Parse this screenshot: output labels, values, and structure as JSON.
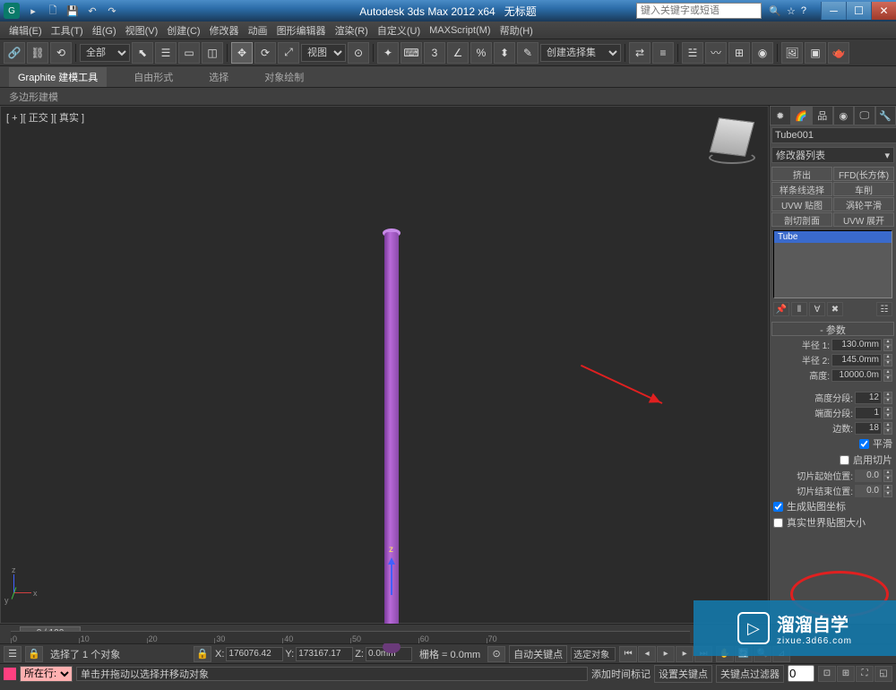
{
  "title": {
    "app": "Autodesk 3ds Max  2012 x64",
    "doc": "无标题"
  },
  "search_placeholder": "键入关键字或短语",
  "menu": [
    "编辑(E)",
    "工具(T)",
    "组(G)",
    "视图(V)",
    "创建(C)",
    "修改器",
    "动画",
    "图形编辑器",
    "渲染(R)",
    "自定义(U)",
    "MAXScript(M)",
    "帮助(H)"
  ],
  "toolbar": {
    "all": "全部",
    "view": "视图",
    "selset": "创建选择集"
  },
  "ribbon": {
    "tabs": [
      "Graphite 建模工具",
      "自由形式",
      "选择",
      "对象绘制"
    ],
    "sub": "多边形建模"
  },
  "viewport": {
    "label": "[ + ][ 正交 ][ 真实 ]",
    "x": "x",
    "y": "y",
    "z": "z"
  },
  "cmd": {
    "object_name": "Tube001",
    "modifier_list": "修改器列表",
    "mod_buttons": [
      "挤出",
      "FFD(长方体)",
      "样条线选择",
      "车削",
      "UVW 贴图",
      "涡轮平滑",
      "剖切剖面",
      "UVW 展开"
    ],
    "stack_item": "Tube",
    "rollout": "参数",
    "params": {
      "radius1_label": "半径 1:",
      "radius1": "130.0mm",
      "radius2_label": "半径 2:",
      "radius2": "145.0mm",
      "height_label": "高度:",
      "height": "10000.0m",
      "heightsegs_label": "高度分段:",
      "heightsegs": "12",
      "capsegs_label": "端面分段:",
      "capsegs": "1",
      "sides_label": "边数:",
      "sides": "18",
      "smooth": "平滑",
      "slice_on": "启用切片",
      "slice_from_label": "切片起始位置:",
      "slice_from": "0.0",
      "slice_to_label": "切片结束位置:",
      "slice_to": "0.0",
      "gen_uv": "生成贴图坐标",
      "real_world": "真实世界贴图大小"
    }
  },
  "timeline": {
    "pos": "0 / 100",
    "ticks": [
      0,
      10,
      20,
      30,
      40,
      50,
      60,
      70
    ]
  },
  "status": {
    "selected": "选择了 1 个对象",
    "x_label": "X:",
    "x": "176076.42",
    "y_label": "Y:",
    "y": "173167.17",
    "z_label": "Z:",
    "z": "0.0mm",
    "grid_label": "栅格",
    "grid": "= 0.0mm",
    "autokey": "自动关键点",
    "selset2": "选定对象",
    "prompt": "单击并拖动以选择并移动对象",
    "add_time": "添加时间标记",
    "set_key": "设置关键点",
    "key_filters": "关键点过滤器",
    "layer": "所在行:"
  },
  "watermark": {
    "main": "溜溜自学",
    "sub": "zixue.3d66.com"
  }
}
